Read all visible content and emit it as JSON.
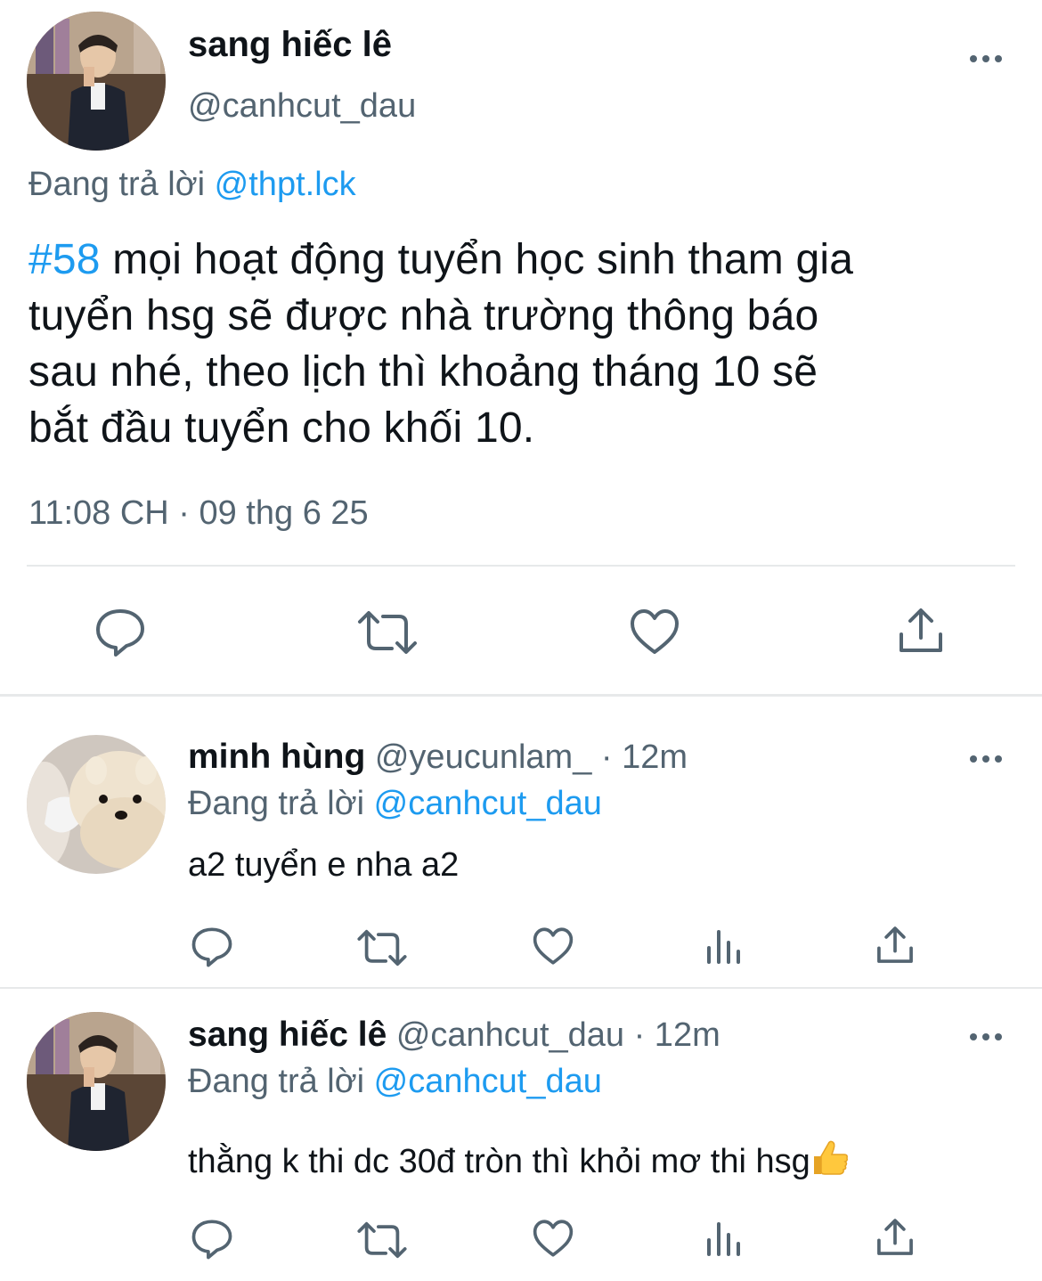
{
  "main_tweet": {
    "display_name": "sang hiếc lê",
    "handle": "@canhcut_dau",
    "replying_prefix": "Đang trả lời",
    "replying_to": "@thpt.lck",
    "hashtag": "#58",
    "text_line1_rest": " mọi hoạt động tuyển học sinh tham gia",
    "text_line2": "tuyển hsg sẽ được nhà trường thông báo",
    "text_line3": "sau nhé, theo lịch thì khoảng tháng 10 sẽ",
    "text_line4": "bắt đầu tuyển cho khối 10.",
    "timestamp": "11:08 CH · 09 thg 6 25",
    "actions": [
      "reply-icon",
      "retweet-icon",
      "like-icon",
      "share-icon"
    ]
  },
  "replies": [
    {
      "display_name": "minh hùng",
      "handle": "@yeucunlam_",
      "time": "· 12m",
      "replying_prefix": "Đang trả lời",
      "replying_to": "@canhcut_dau",
      "text": "a2 tuyển e nha a2",
      "actions": [
        "reply-icon",
        "retweet-icon",
        "like-icon",
        "analytics-icon",
        "share-icon"
      ]
    },
    {
      "display_name": "sang hiếc lê",
      "handle": "@canhcut_dau",
      "time": "· 12m",
      "replying_prefix": "Đang trả lời",
      "replying_to": "@canhcut_dau",
      "text": "thằng k thi dc 30đ tròn thì khỏi mơ thi hsg",
      "emoji": "thumbs-up",
      "actions": [
        "reply-icon",
        "retweet-icon",
        "like-icon",
        "analytics-icon",
        "share-icon"
      ]
    }
  ],
  "colors": {
    "accent": "#1d9bf0",
    "secondary_text": "#536471",
    "primary_text": "#0f1419",
    "divider": "#e7e9ea"
  }
}
